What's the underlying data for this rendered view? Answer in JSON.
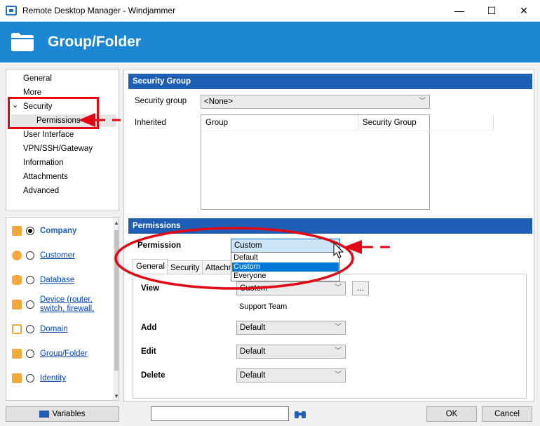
{
  "window": {
    "title": "Remote Desktop Manager - Windjammer",
    "minimize": "—",
    "maximize": "☐",
    "close": "✕"
  },
  "header": {
    "title": "Group/Folder"
  },
  "nav": {
    "items": [
      {
        "label": "General"
      },
      {
        "label": "More"
      },
      {
        "label": "Security"
      },
      {
        "label": "Permissions"
      },
      {
        "label": "User Interface"
      },
      {
        "label": "VPN/SSH/Gateway"
      },
      {
        "label": "Information"
      },
      {
        "label": "Attachments"
      },
      {
        "label": "Advanced"
      }
    ],
    "expanded_chevron": "⌄"
  },
  "categories": [
    {
      "label": "Company",
      "selected": true,
      "icon": "building-icon"
    },
    {
      "label": "Customer",
      "icon": "person-icon"
    },
    {
      "label": "Database",
      "icon": "database-icon"
    },
    {
      "label": "Device (router,",
      "label2": "switch, firewall,",
      "icon": "router-icon"
    },
    {
      "label": "Domain",
      "icon": "domain-icon"
    },
    {
      "label": "Group/Folder",
      "icon": "folder-icon"
    },
    {
      "label": "Identity",
      "icon": "id-card-icon"
    }
  ],
  "security_group": {
    "title": "Security Group",
    "field_label": "Security group",
    "value": "<None>",
    "inherited_label": "Inherited",
    "columns": [
      "Group",
      "Security Group"
    ]
  },
  "permissions": {
    "title": "Permissions",
    "field_label": "Permission",
    "value": "Custom",
    "dropdown_options": [
      "Default",
      "Custom",
      "Everyone"
    ],
    "highlighted_option": "Custom",
    "tabs": [
      "General",
      "Security",
      "Attachm"
    ],
    "rows": [
      {
        "label": "View",
        "value": "Custom",
        "note": "Support Team",
        "ellipsis": "..."
      },
      {
        "label": "Add",
        "value": "Default"
      },
      {
        "label": "Edit",
        "value": "Default"
      },
      {
        "label": "Delete",
        "value": "Default"
      }
    ]
  },
  "bottom": {
    "variables": "Variables",
    "ok": "OK",
    "cancel": "Cancel"
  },
  "colors": {
    "header_blue": "#1b87d3",
    "section_blue": "#1e5eb4",
    "annotation_red": "#e30613",
    "highlight": "#0078d7"
  }
}
